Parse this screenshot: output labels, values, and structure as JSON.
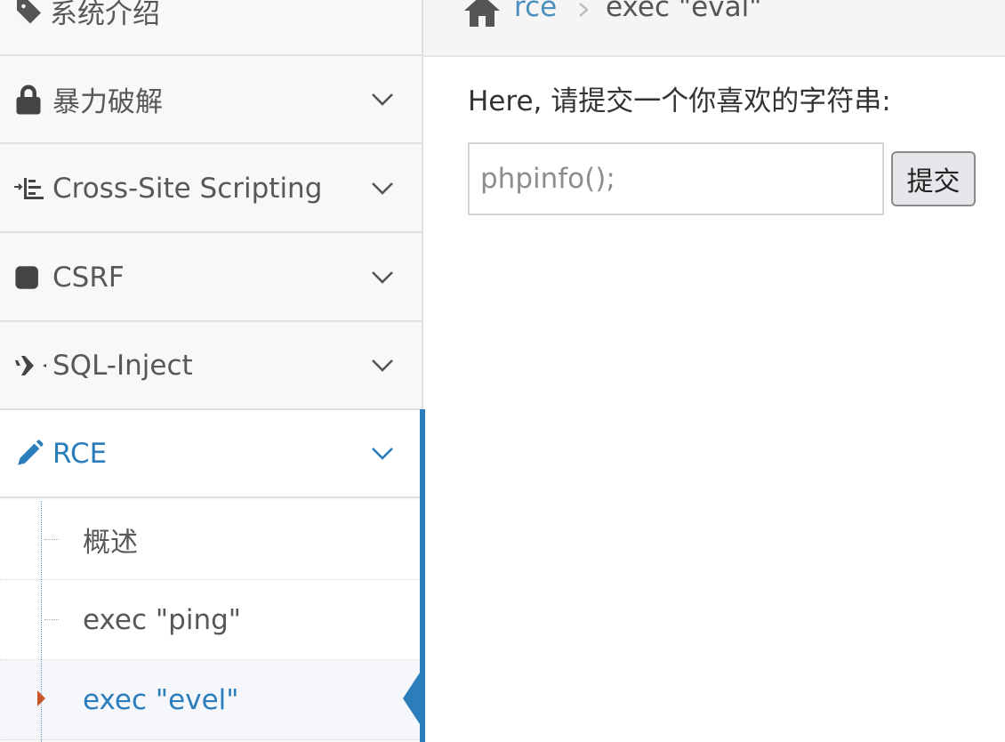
{
  "sidebar": {
    "items": [
      {
        "label": "系统介绍",
        "icon": "tag-icon"
      },
      {
        "label": "暴力破解",
        "icon": "lock-icon"
      },
      {
        "label": "Cross-Site Scripting",
        "icon": "list-icon"
      },
      {
        "label": "CSRF",
        "icon": "share-icon"
      },
      {
        "label": "SQL-Inject",
        "icon": "plane-icon"
      },
      {
        "label": "RCE",
        "icon": "pencil-icon",
        "active": true
      }
    ],
    "rce_sub": [
      {
        "label": "概述"
      },
      {
        "label": "exec \"ping\""
      },
      {
        "label": "exec \"evel\"",
        "active": true
      }
    ]
  },
  "breadcrumb": {
    "link": "rce",
    "current": "exec \"eval\""
  },
  "main": {
    "prompt": "Here, 请提交一个你喜欢的字符串:",
    "input_placeholder": "phpinfo();",
    "submit_label": "提交"
  },
  "colors": {
    "accent": "#2b7dbc",
    "sidebar_bg": "#f8f8f8",
    "caret": "#c9562a"
  }
}
